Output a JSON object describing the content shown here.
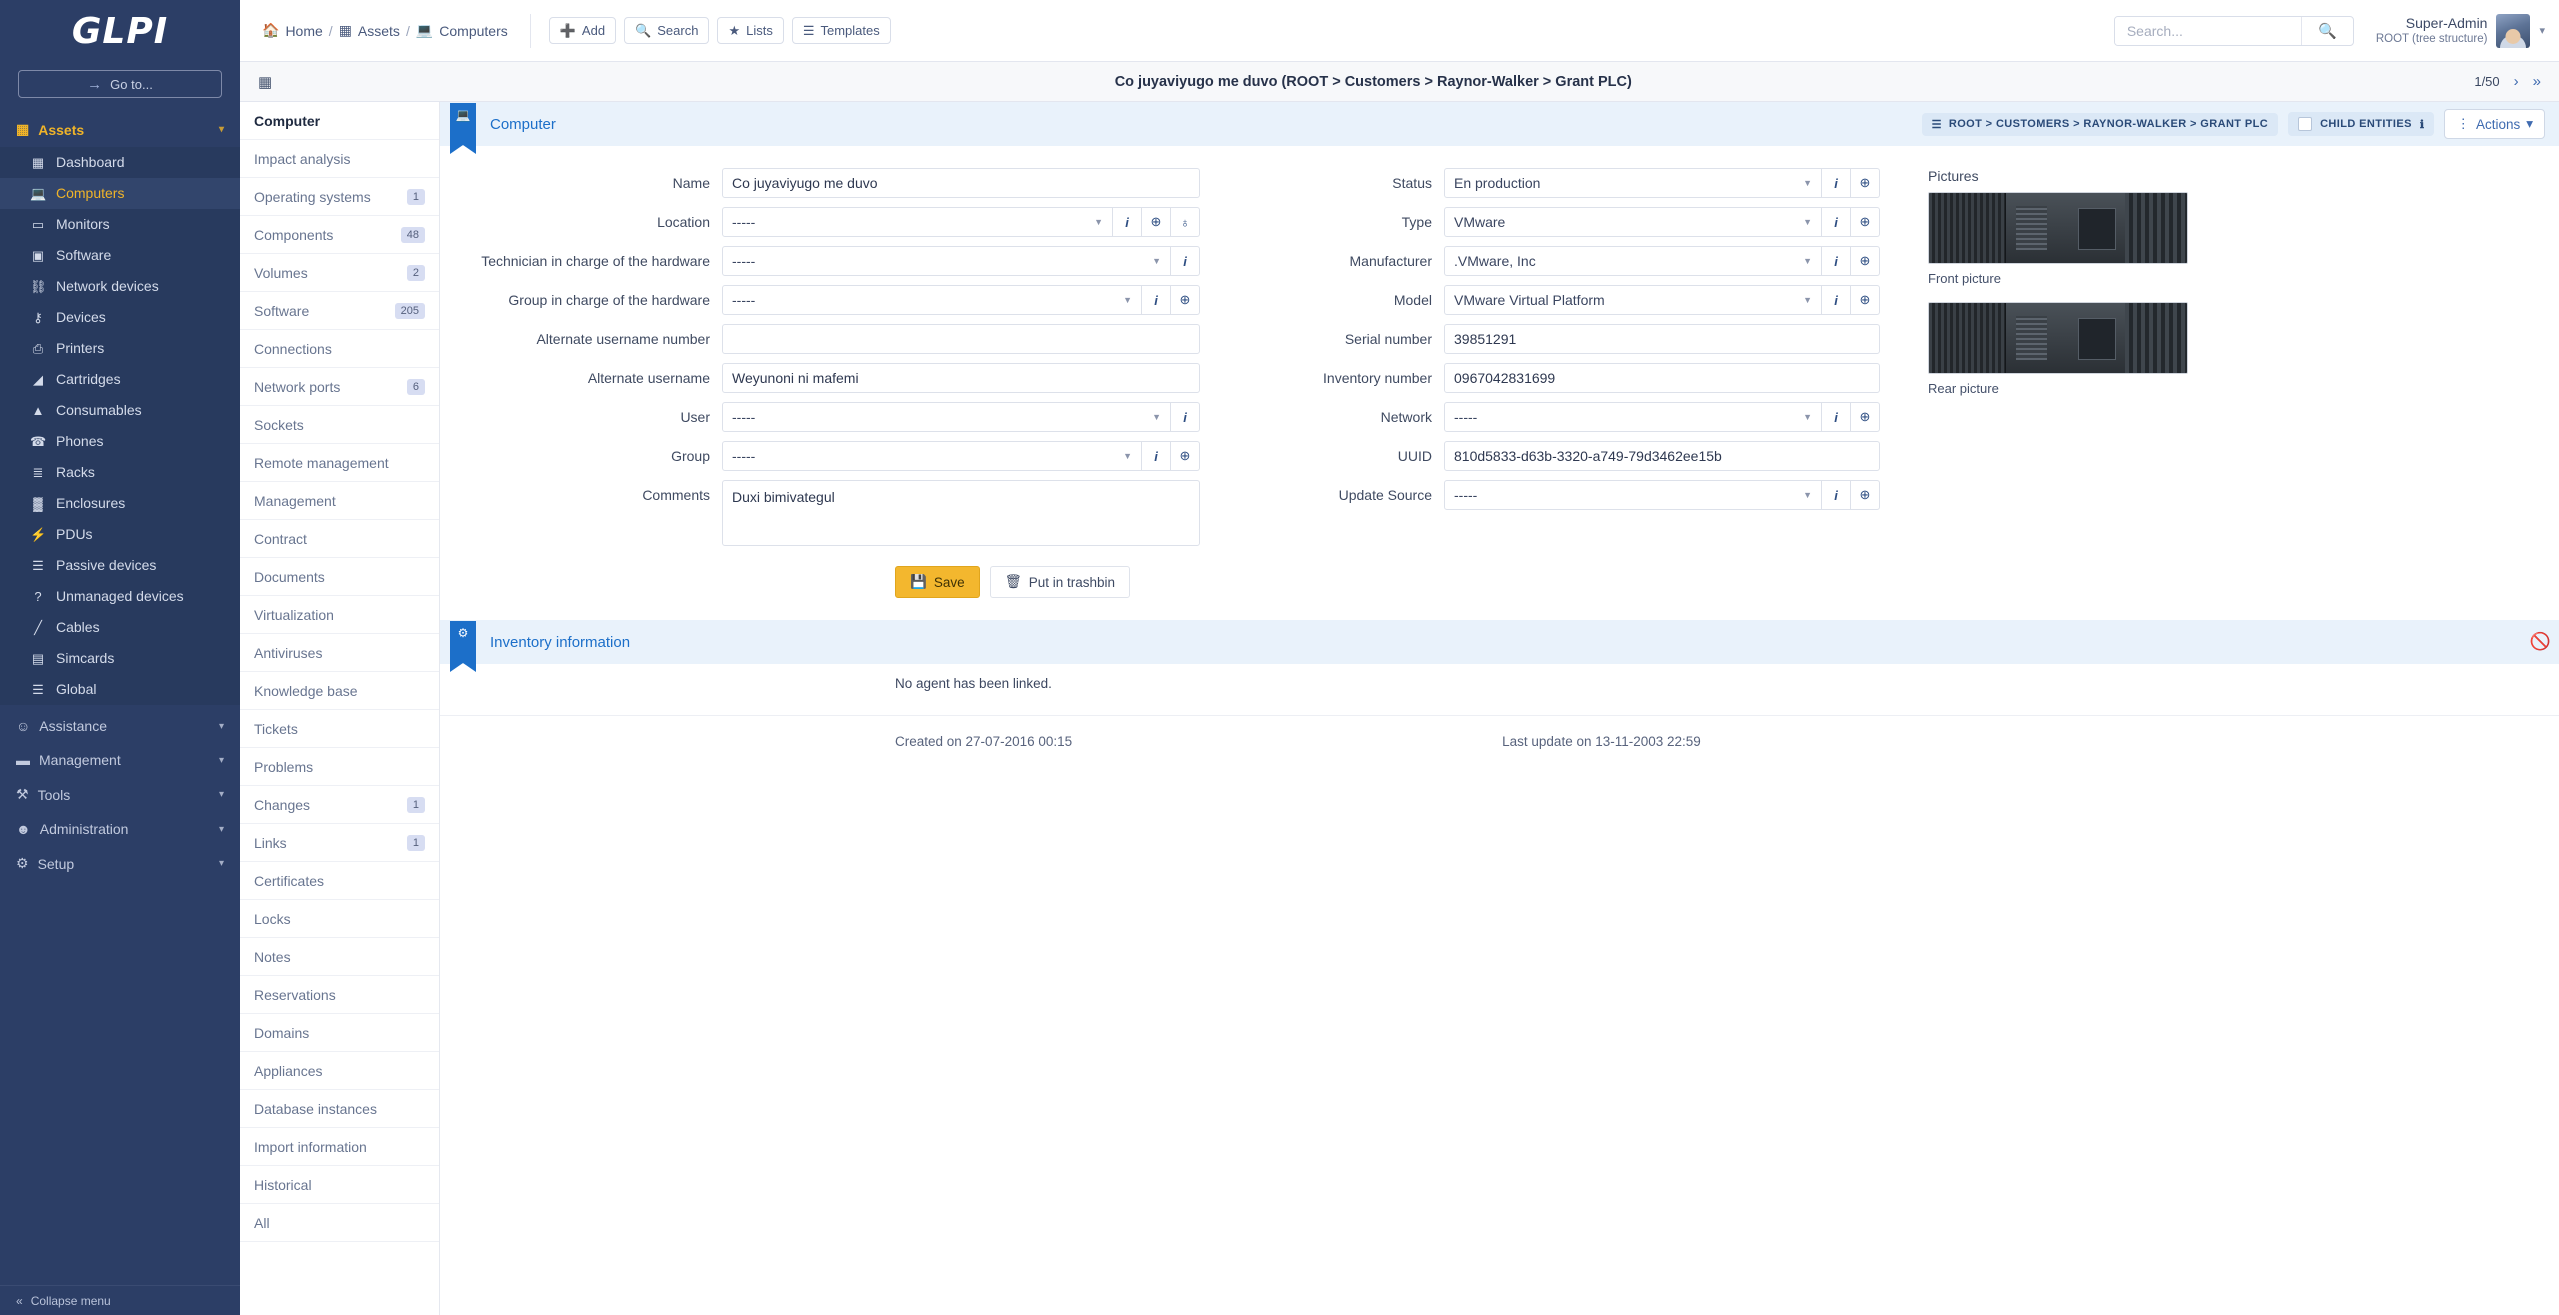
{
  "brand": {
    "logo": "GLPI",
    "goto_label": "Go to...",
    "collapse_label": "Collapse menu"
  },
  "sidebar": {
    "sections": [
      {
        "label": "Assets",
        "icon": "boxes-icon",
        "expanded": true
      },
      {
        "label": "Assistance",
        "icon": "headset-icon",
        "expanded": false
      },
      {
        "label": "Management",
        "icon": "wallet-icon",
        "expanded": false
      },
      {
        "label": "Tools",
        "icon": "toolbox-icon",
        "expanded": false
      },
      {
        "label": "Administration",
        "icon": "user-shield-icon",
        "expanded": false
      },
      {
        "label": "Setup",
        "icon": "cogs-icon",
        "expanded": false
      }
    ],
    "assets_items": [
      {
        "label": "Dashboard",
        "icon": "grid-icon",
        "active": false
      },
      {
        "label": "Computers",
        "icon": "laptop-icon",
        "active": true
      },
      {
        "label": "Monitors",
        "icon": "monitor-icon",
        "active": false
      },
      {
        "label": "Software",
        "icon": "box-icon",
        "active": false
      },
      {
        "label": "Network devices",
        "icon": "network-icon",
        "active": false
      },
      {
        "label": "Devices",
        "icon": "usb-icon",
        "active": false
      },
      {
        "label": "Printers",
        "icon": "printer-icon",
        "active": false
      },
      {
        "label": "Cartridges",
        "icon": "inkdrop-icon",
        "active": false
      },
      {
        "label": "Consumables",
        "icon": "consumable-icon",
        "active": false
      },
      {
        "label": "Phones",
        "icon": "phone-icon",
        "active": false
      },
      {
        "label": "Racks",
        "icon": "rack-icon",
        "active": false
      },
      {
        "label": "Enclosures",
        "icon": "enclosure-icon",
        "active": false
      },
      {
        "label": "PDUs",
        "icon": "plug-icon",
        "active": false
      },
      {
        "label": "Passive devices",
        "icon": "list-icon",
        "active": false
      },
      {
        "label": "Unmanaged devices",
        "icon": "question-icon",
        "active": false
      },
      {
        "label": "Cables",
        "icon": "cable-icon",
        "active": false
      },
      {
        "label": "Simcards",
        "icon": "simcard-icon",
        "active": false
      },
      {
        "label": "Global",
        "icon": "list-icon",
        "active": false
      }
    ]
  },
  "topbar": {
    "breadcrumb": [
      {
        "label": "Home",
        "icon": "home-icon"
      },
      {
        "label": "Assets",
        "icon": "boxes-icon"
      },
      {
        "label": "Computers",
        "icon": "laptop-icon"
      }
    ],
    "separator": "/",
    "buttons": [
      {
        "label": "Add",
        "icon": "plus-icon"
      },
      {
        "label": "Search",
        "icon": "search-icon"
      },
      {
        "label": "Lists",
        "icon": "star-icon"
      },
      {
        "label": "Templates",
        "icon": "layers-icon"
      }
    ],
    "search": {
      "placeholder": "Search...",
      "value": ""
    },
    "user": {
      "name": "Super-Admin",
      "entity": "ROOT (tree structure)"
    }
  },
  "titlerow": {
    "title": "Co juyaviyugo me duvo (ROOT > Customers > Raynor-Walker > Grant PLC)",
    "pager": {
      "position": "1/50",
      "next": "›",
      "last": "»"
    }
  },
  "tabs": [
    {
      "label": "Computer",
      "badge": "",
      "active": true
    },
    {
      "label": "Impact analysis",
      "badge": "",
      "active": false
    },
    {
      "label": "Operating systems",
      "badge": "1",
      "active": false
    },
    {
      "label": "Components",
      "badge": "48",
      "active": false
    },
    {
      "label": "Volumes",
      "badge": "2",
      "active": false
    },
    {
      "label": "Software",
      "badge": "205",
      "active": false
    },
    {
      "label": "Connections",
      "badge": "",
      "active": false
    },
    {
      "label": "Network ports",
      "badge": "6",
      "active": false
    },
    {
      "label": "Sockets",
      "badge": "",
      "active": false
    },
    {
      "label": "Remote management",
      "badge": "",
      "active": false
    },
    {
      "label": "Management",
      "badge": "",
      "active": false
    },
    {
      "label": "Contract",
      "badge": "",
      "active": false
    },
    {
      "label": "Documents",
      "badge": "",
      "active": false
    },
    {
      "label": "Virtualization",
      "badge": "",
      "active": false
    },
    {
      "label": "Antiviruses",
      "badge": "",
      "active": false
    },
    {
      "label": "Knowledge base",
      "badge": "",
      "active": false
    },
    {
      "label": "Tickets",
      "badge": "",
      "active": false
    },
    {
      "label": "Problems",
      "badge": "",
      "active": false
    },
    {
      "label": "Changes",
      "badge": "1",
      "active": false
    },
    {
      "label": "Links",
      "badge": "1",
      "active": false
    },
    {
      "label": "Certificates",
      "badge": "",
      "active": false
    },
    {
      "label": "Locks",
      "badge": "",
      "active": false
    },
    {
      "label": "Notes",
      "badge": "",
      "active": false
    },
    {
      "label": "Reservations",
      "badge": "",
      "active": false
    },
    {
      "label": "Domains",
      "badge": "",
      "active": false
    },
    {
      "label": "Appliances",
      "badge": "",
      "active": false
    },
    {
      "label": "Database instances",
      "badge": "",
      "active": false
    },
    {
      "label": "Import information",
      "badge": "",
      "active": false
    },
    {
      "label": "Historical",
      "badge": "",
      "active": false
    },
    {
      "label": "All",
      "badge": "",
      "active": false
    }
  ],
  "panel": {
    "section_title": "Computer",
    "entity_path": "ROOT > CUSTOMERS > RAYNOR-WALKER > GRANT PLC",
    "child_entities_label": "Child entities",
    "actions_label": "Actions"
  },
  "form": {
    "left": [
      {
        "label": "Name",
        "type": "text",
        "value": "Co juyaviyugo me duvo",
        "adorns": []
      },
      {
        "label": "Location",
        "type": "select",
        "value": "-----",
        "adorns": [
          "info",
          "plus",
          "globe"
        ]
      },
      {
        "label": "Technician in charge of the hardware",
        "type": "select",
        "value": "-----",
        "adorns": [
          "info"
        ]
      },
      {
        "label": "Group in charge of the hardware",
        "type": "select",
        "value": "-----",
        "adorns": [
          "info",
          "plus"
        ]
      },
      {
        "label": "Alternate username number",
        "type": "text",
        "value": "",
        "adorns": []
      },
      {
        "label": "Alternate username",
        "type": "text",
        "value": "Weyunoni ni mafemi",
        "adorns": []
      },
      {
        "label": "User",
        "type": "select",
        "value": "-----",
        "adorns": [
          "info"
        ]
      },
      {
        "label": "Group",
        "type": "select",
        "value": "-----",
        "adorns": [
          "info",
          "plus"
        ]
      },
      {
        "label": "Comments",
        "type": "textarea",
        "value": "Duxi bimivategul",
        "adorns": []
      }
    ],
    "right": [
      {
        "label": "Status",
        "type": "select",
        "value": "En production",
        "adorns": [
          "info",
          "plus"
        ]
      },
      {
        "label": "Type",
        "type": "select",
        "value": "VMware",
        "adorns": [
          "info",
          "plus"
        ]
      },
      {
        "label": "Manufacturer",
        "type": "select",
        "value": ".VMware, Inc",
        "adorns": [
          "info",
          "plus"
        ]
      },
      {
        "label": "Model",
        "type": "select",
        "value": "VMware Virtual Platform",
        "adorns": [
          "info",
          "plus"
        ]
      },
      {
        "label": "Serial number",
        "type": "text",
        "value": "39851291",
        "adorns": []
      },
      {
        "label": "Inventory number",
        "type": "text",
        "value": "0967042831699",
        "adorns": []
      },
      {
        "label": "Network",
        "type": "select",
        "value": "-----",
        "adorns": [
          "info",
          "plus"
        ]
      },
      {
        "label": "UUID",
        "type": "text",
        "value": "810d5833-d63b-3320-a749-79d3462ee15b",
        "adorns": []
      },
      {
        "label": "Update Source",
        "type": "select",
        "value": "-----",
        "adorns": [
          "info",
          "plus"
        ]
      }
    ],
    "pictures": {
      "title": "Pictures",
      "front_caption": "Front picture",
      "rear_caption": "Rear picture"
    },
    "save_label": "Save",
    "trash_label": "Put in trashbin"
  },
  "inventory": {
    "section_title": "Inventory information",
    "message": "No agent has been linked."
  },
  "meta": {
    "created": "Created on 27-07-2016 00:15",
    "updated": "Last update on 13-11-2003 22:59"
  },
  "colors": {
    "sidebar": "#2c3e66",
    "accent_yellow": "#f0b429",
    "link_blue": "#1c6fc9",
    "save_yellow": "#f3b72e"
  }
}
